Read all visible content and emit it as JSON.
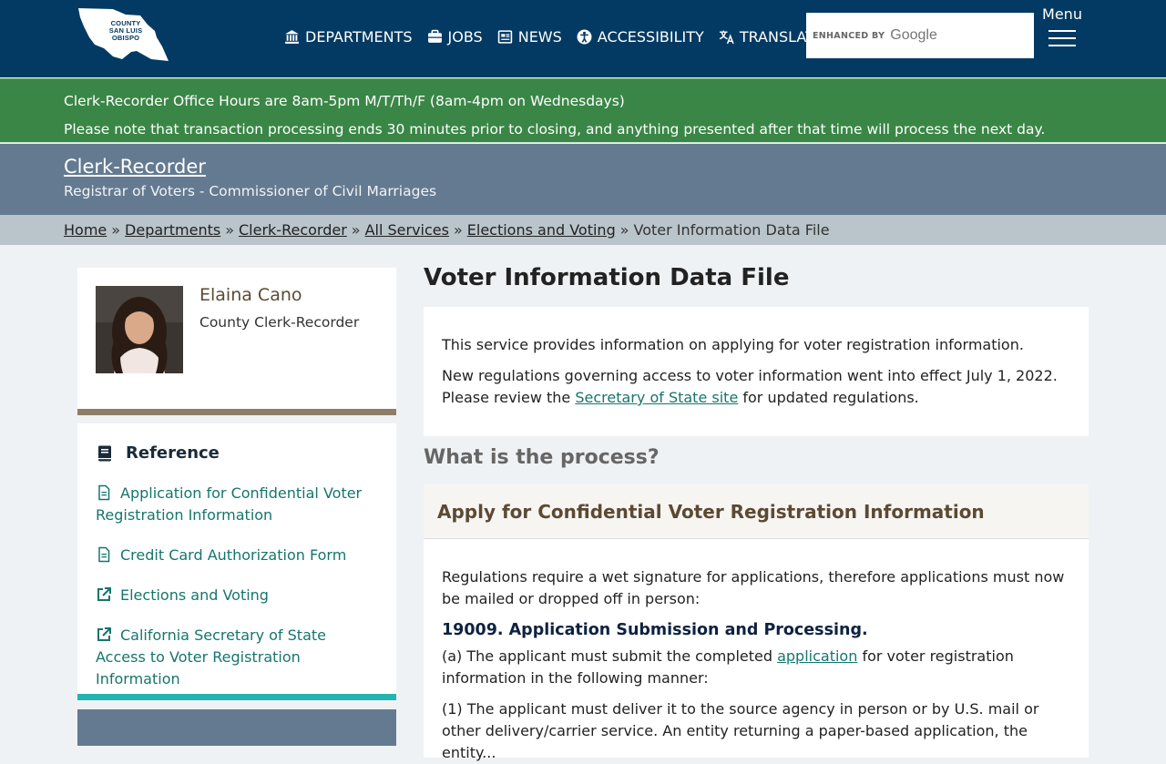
{
  "header": {
    "logo": {
      "line1": "COUNTY",
      "line2": "SAN LUIS",
      "line3": "OBISPO",
      "icon": "county-shape-logo"
    },
    "nav": [
      {
        "label": "DEPARTMENTS",
        "icon": "building-icon"
      },
      {
        "label": "JOBS",
        "icon": "briefcase-icon"
      },
      {
        "label": "NEWS",
        "icon": "newspaper-icon"
      },
      {
        "label": "ACCESSIBILITY",
        "icon": "accessibility-icon"
      },
      {
        "label": "TRANSLATE",
        "icon": "translate-icon"
      }
    ],
    "search": {
      "enhanced_by": "ENHANCED BY",
      "brand": "Google"
    },
    "menu_label": "Menu",
    "background": "#033a63"
  },
  "alert": {
    "line1": "Clerk-Recorder Office Hours are 8am-5pm M/T/Th/F (8am-4pm on Wednesdays)",
    "line2": "Please note that transaction processing ends 30 minutes prior to closing, and anything presented after that time will process the next day.",
    "background": "#3a8646"
  },
  "department": {
    "name": "Clerk-Recorder",
    "subtitle": "Registrar of Voters - Commissioner of Civil Marriages"
  },
  "breadcrumb": {
    "items": [
      "Home",
      "Departments",
      "Clerk-Recorder",
      "All Services",
      "Elections and Voting"
    ],
    "current": "Voter Information Data File",
    "separator": "»"
  },
  "sidebar": {
    "official": {
      "name": "Elaina Cano",
      "title": "County Clerk-Recorder"
    },
    "reference": {
      "heading": "Reference",
      "items": [
        {
          "label": "Application for Confidential Voter Registration Information",
          "icon": "document-icon"
        },
        {
          "label": "Credit Card Authorization Form",
          "icon": "document-icon"
        },
        {
          "label": "Elections and Voting",
          "icon": "external-link-icon"
        },
        {
          "label": "California Secretary of State Access to Voter Registration Information",
          "icon": "external-link-icon"
        }
      ]
    }
  },
  "main": {
    "title": "Voter Information Data File",
    "intro": {
      "p1": "This service provides information on applying for voter registration information.",
      "p2_before": "New regulations governing access to voter information went into effect July 1, 2022. Please review the ",
      "p2_link": "Secretary of State site",
      "p2_after": " for updated regulations."
    },
    "process_heading": "What is the process?",
    "accordion": {
      "title": "Apply for Confidential Voter Registration Information",
      "p1": "Regulations require a wet signature for applications, therefore applications must now be mailed or dropped off in person:",
      "section_heading": "19009. Application Submission and Processing.",
      "p2_before": "(a) The applicant must submit the completed ",
      "p2_link": "application",
      "p2_after": " for voter registration information in the following manner:",
      "p3": "(1) The applicant must deliver it to the source agency in person or by U.S. mail or other delivery/carrier service. An entity returning a paper-based application, the entity..."
    }
  }
}
